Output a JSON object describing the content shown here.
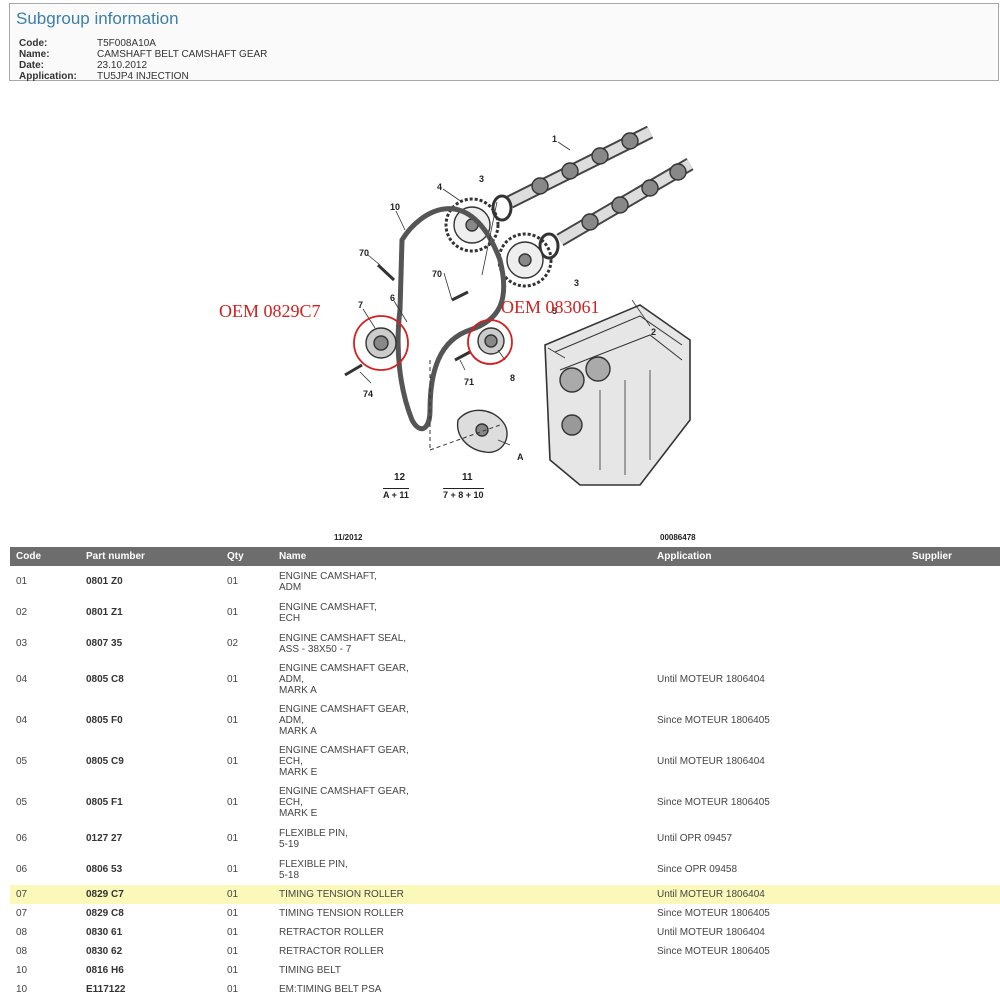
{
  "header": {
    "title": "Subgroup information",
    "fields": [
      {
        "label": "Code:",
        "value": "T5F008A10A"
      },
      {
        "label": "Name:",
        "value": "CAMSHAFT BELT CAMSHAFT GEAR"
      },
      {
        "label": "Date:",
        "value": "23.10.2012"
      },
      {
        "label": "Application:",
        "value": "TU5JP4 INJECTION"
      }
    ]
  },
  "diagram": {
    "oem_left": "OEM 0829C7",
    "oem_right": "OEM 083061",
    "callouts": [
      "1",
      "2",
      "3",
      "4",
      "3",
      "10",
      "70",
      "70",
      "7",
      "6",
      "5",
      "8",
      "71",
      "74",
      "A"
    ],
    "group_12_num": "12",
    "group_12_formula": "A + 11",
    "group_11_num": "11",
    "group_11_formula": "7 + 8 + 10",
    "date_code": "11/2012",
    "ref_code": "00086478",
    "highlight_color": "#d42020"
  },
  "table": {
    "columns": [
      "Code",
      "Part number",
      "Qty",
      "Name",
      "Application",
      "Supplier"
    ],
    "rows": [
      {
        "code": "01",
        "part": "0801 Z0",
        "qty": "01",
        "name": [
          "ENGINE CAMSHAFT,",
          "ADM"
        ],
        "application": "",
        "supplier": ""
      },
      {
        "code": "02",
        "part": "0801 Z1",
        "qty": "01",
        "name": [
          "ENGINE CAMSHAFT,",
          "ECH"
        ],
        "application": "",
        "supplier": ""
      },
      {
        "code": "03",
        "part": "0807 35",
        "qty": "02",
        "name": [
          "ENGINE CAMSHAFT SEAL,",
          "ASS - 38X50 - 7"
        ],
        "application": "",
        "supplier": ""
      },
      {
        "code": "04",
        "part": "0805 C8",
        "qty": "01",
        "name": [
          "ENGINE CAMSHAFT GEAR,",
          "ADM,",
          "MARK A"
        ],
        "application": "Until MOTEUR 1806404",
        "supplier": ""
      },
      {
        "code": "04",
        "part": "0805 F0",
        "qty": "01",
        "name": [
          "ENGINE CAMSHAFT GEAR,",
          "ADM,",
          "MARK A"
        ],
        "application": "Since MOTEUR 1806405",
        "supplier": ""
      },
      {
        "code": "05",
        "part": "0805 C9",
        "qty": "01",
        "name": [
          "ENGINE CAMSHAFT GEAR,",
          "ECH,",
          "MARK E"
        ],
        "application": "Until MOTEUR 1806404",
        "supplier": ""
      },
      {
        "code": "05",
        "part": "0805 F1",
        "qty": "01",
        "name": [
          "ENGINE CAMSHAFT GEAR,",
          "ECH,",
          "MARK E"
        ],
        "application": "Since MOTEUR 1806405",
        "supplier": ""
      },
      {
        "code": "06",
        "part": "0127 27",
        "qty": "01",
        "name": [
          "FLEXIBLE PIN,",
          "5-19"
        ],
        "application": "Until OPR 09457",
        "supplier": ""
      },
      {
        "code": "06",
        "part": "0806 53",
        "qty": "01",
        "name": [
          "FLEXIBLE PIN,",
          "5-18"
        ],
        "application": "Since OPR 09458",
        "supplier": ""
      },
      {
        "code": "07",
        "part": "0829 C7",
        "qty": "01",
        "name": [
          "TIMING TENSION ROLLER"
        ],
        "application": "Until MOTEUR 1806404",
        "supplier": "",
        "highlight": true
      },
      {
        "code": "07",
        "part": "0829 C8",
        "qty": "01",
        "name": [
          "TIMING TENSION ROLLER"
        ],
        "application": "Since MOTEUR 1806405",
        "supplier": ""
      },
      {
        "code": "08",
        "part": "0830 61",
        "qty": "01",
        "name": [
          "RETRACTOR ROLLER"
        ],
        "application": "Until MOTEUR 1806404",
        "supplier": ""
      },
      {
        "code": "08",
        "part": "0830 62",
        "qty": "01",
        "name": [
          "RETRACTOR ROLLER"
        ],
        "application": "Since MOTEUR 1806405",
        "supplier": ""
      },
      {
        "code": "10",
        "part": "0816 H6",
        "qty": "01",
        "name": [
          "TIMING BELT"
        ],
        "application": "",
        "supplier": ""
      },
      {
        "code": "10",
        "part": "E117122",
        "qty": "01",
        "name": [
          "EM:TIMING BELT PSA"
        ],
        "application": "",
        "supplier": ""
      }
    ]
  }
}
